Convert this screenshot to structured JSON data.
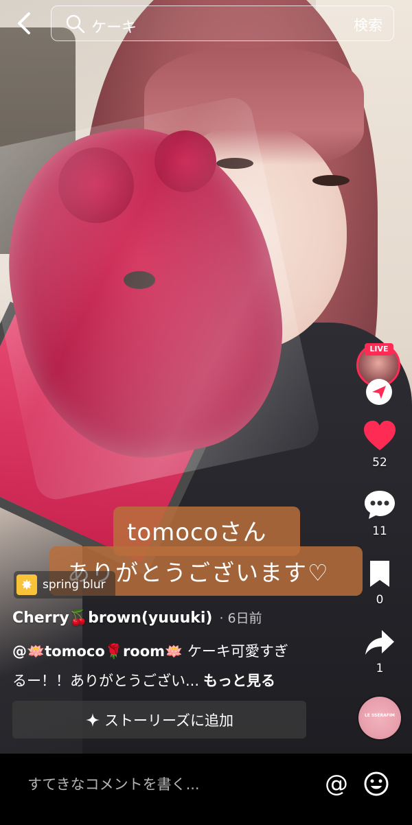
{
  "search": {
    "query": "ケーキ",
    "button_label": "検索"
  },
  "rail": {
    "live_label": "LIVE",
    "likes": "52",
    "comments": "11",
    "saves": "0",
    "shares": "1",
    "music_disc_text": "LE SSERAFIM"
  },
  "sticker": {
    "line1": "tomocoさん",
    "line2": "ありがとうございます♡"
  },
  "effect": {
    "icon": "fireworks-icon",
    "label": "spring blur"
  },
  "author": {
    "name": "Cherry🍒brown(yuuuki)",
    "time": "· 6日前"
  },
  "caption": {
    "mention": "@🪷tomoco🌹room🪷",
    "line1_rest": " ケーキ可愛すぎ",
    "line2": "るー！！ありがとうござい...",
    "more": "もっと見る"
  },
  "stories_button": {
    "label": "ストーリーズに追加"
  },
  "comment_bar": {
    "placeholder": "すてきなコメントを書く..."
  },
  "colors": {
    "accent": "#fe2c55",
    "sticker_bg": "#b86e3c"
  }
}
